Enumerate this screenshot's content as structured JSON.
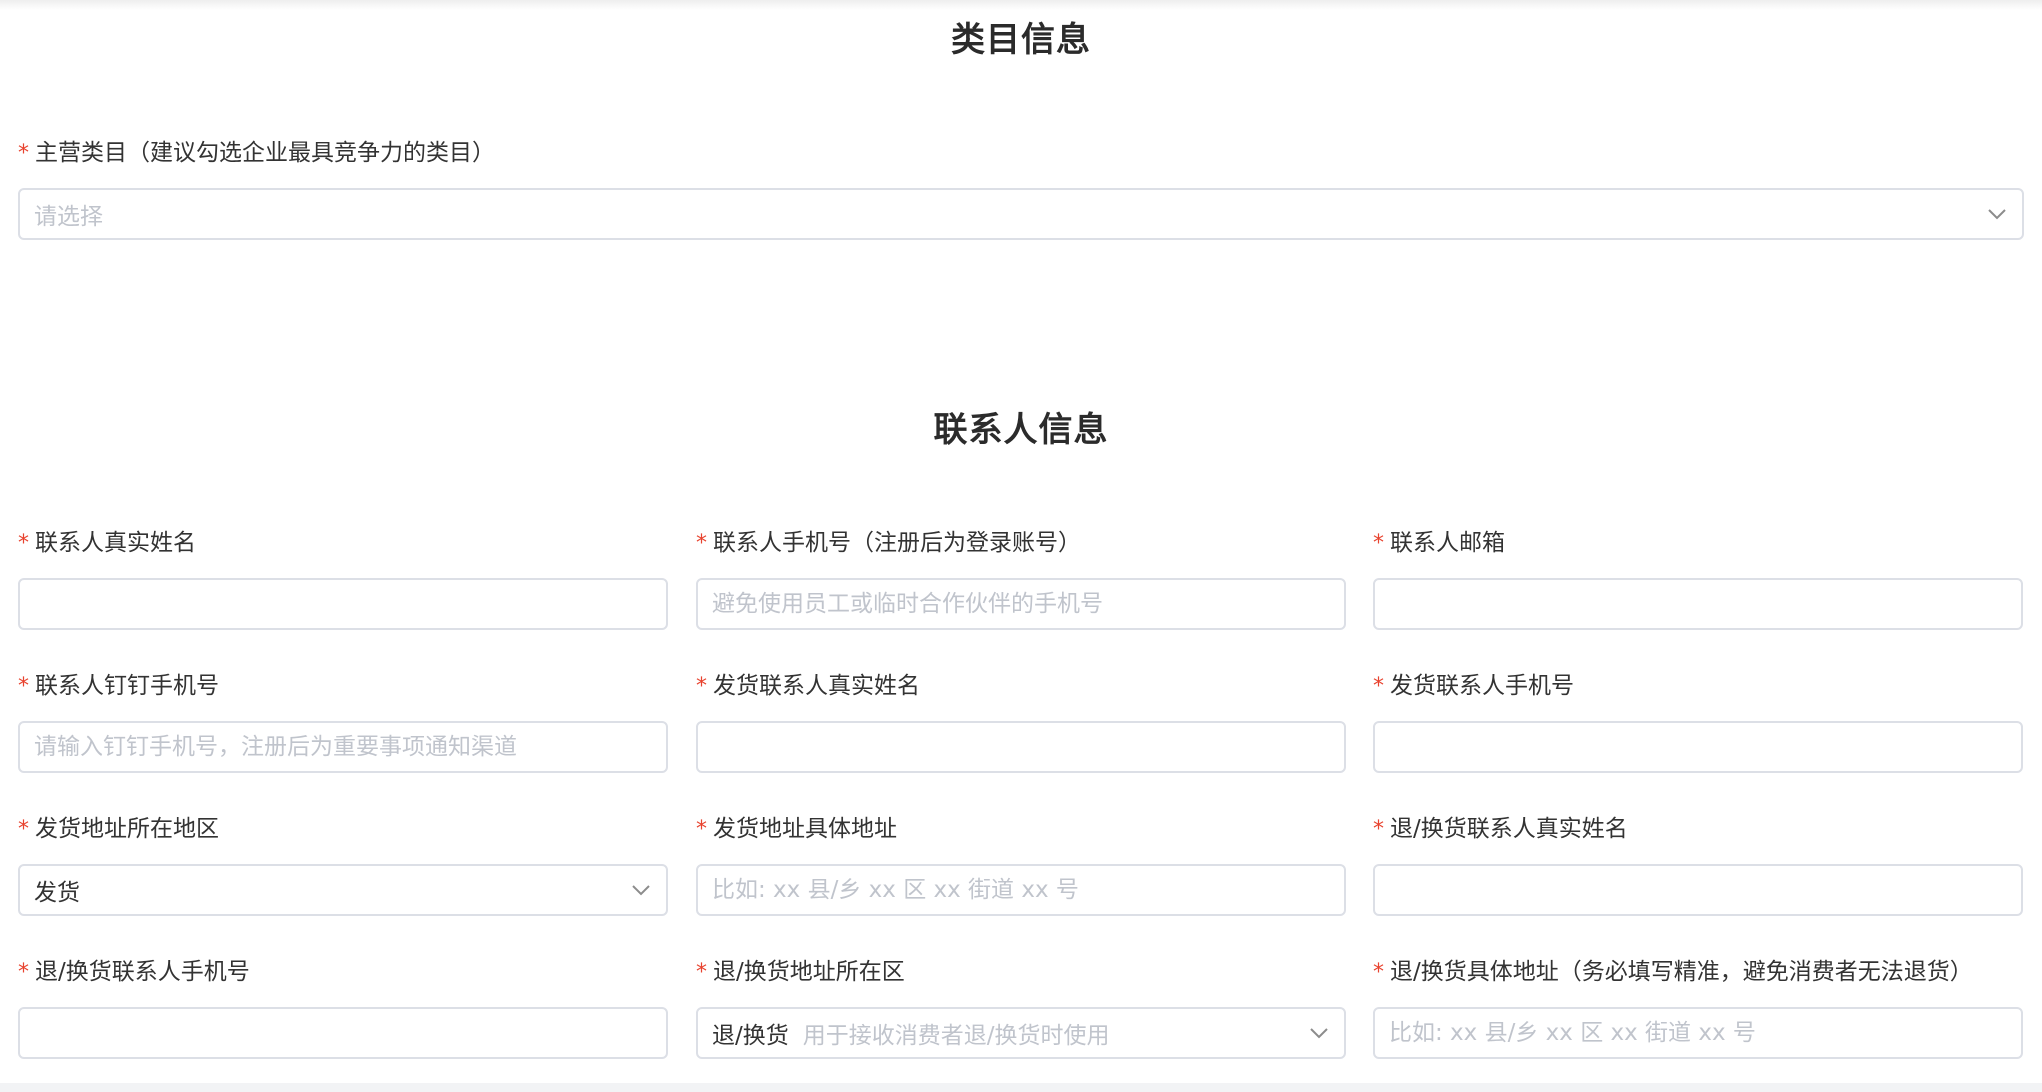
{
  "sections": {
    "category": {
      "title": "类目信息",
      "main_category": {
        "label": "主营类目（建议勾选企业最具竞争力的类目）",
        "placeholder": "请选择"
      }
    },
    "contact": {
      "title": "联系人信息",
      "fields": {
        "contact_name": {
          "label": "联系人真实姓名",
          "placeholder": ""
        },
        "contact_phone": {
          "label": "联系人手机号（注册后为登录账号）",
          "placeholder": "避免使用员工或临时合作伙伴的手机号"
        },
        "contact_email": {
          "label": "联系人邮箱",
          "placeholder": ""
        },
        "dingtalk_phone": {
          "label": "联系人钉钉手机号",
          "placeholder": "请输入钉钉手机号，注册后为重要事项通知渠道"
        },
        "ship_contact_name": {
          "label": "发货联系人真实姓名",
          "placeholder": ""
        },
        "ship_contact_phone": {
          "label": "发货联系人手机号",
          "placeholder": ""
        },
        "ship_region": {
          "label": "发货地址所在地区",
          "value": "发货"
        },
        "ship_address": {
          "label": "发货地址具体地址",
          "placeholder": "比如: xx 县/乡 xx 区 xx 街道 xx 号"
        },
        "return_contact_name": {
          "label": "退/换货联系人真实姓名",
          "placeholder": ""
        },
        "return_contact_phone": {
          "label": "退/换货联系人手机号",
          "placeholder": ""
        },
        "return_region": {
          "label": "退/换货地址所在区",
          "value": "退/换货",
          "placeholder": "用于接收消费者退/换货时使用"
        },
        "return_address": {
          "label": "退/换货具体地址（务必填写精准，避免消费者无法退货）",
          "placeholder": "比如: xx 县/乡 xx 区 xx 街道 xx 号"
        }
      }
    }
  },
  "required_mark": "*",
  "colors": {
    "required": "#e8432f",
    "border": "#dcdfe6",
    "placeholder": "#c0c4cc",
    "text": "#333333"
  },
  "icons": {
    "select_arrow": "chevron-down-icon"
  }
}
